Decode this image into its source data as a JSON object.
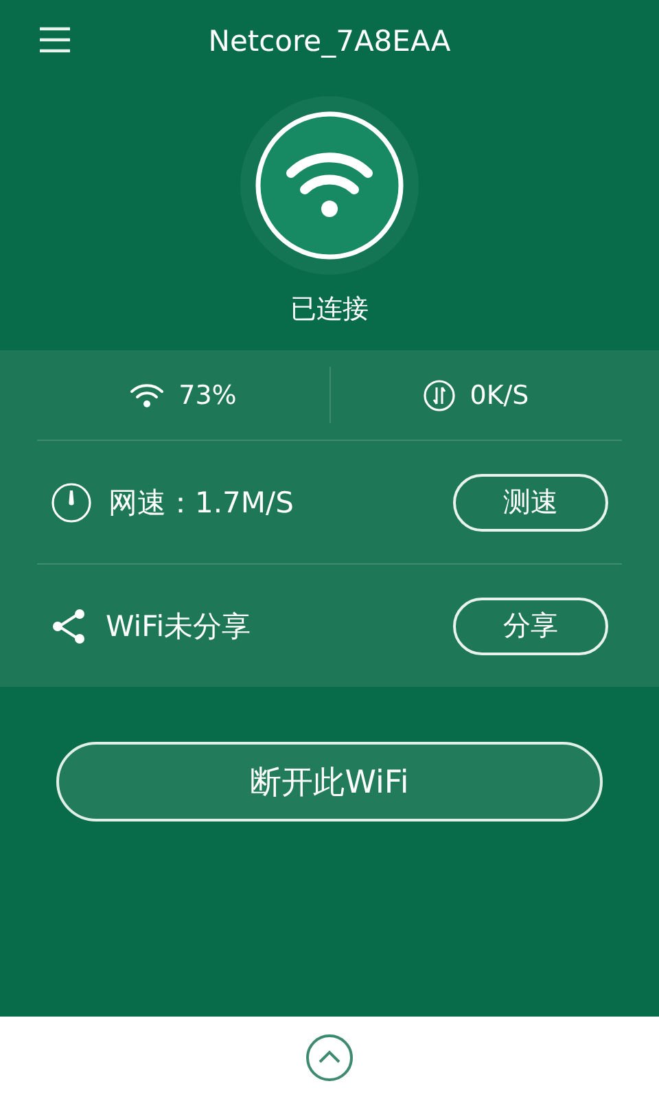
{
  "header": {
    "title": "Netcore_7A8EAA",
    "status": "已连接"
  },
  "stats": [
    {
      "kind": "signal",
      "text": "73%"
    },
    {
      "kind": "traffic",
      "text": "0K/S"
    }
  ],
  "rows": [
    {
      "kind": "speed",
      "label": "网速：1.7M/S",
      "button": "测速"
    },
    {
      "kind": "share",
      "label": "WiFi未分享",
      "button": "分享"
    }
  ],
  "disconnect_button": "断开此WiFi"
}
